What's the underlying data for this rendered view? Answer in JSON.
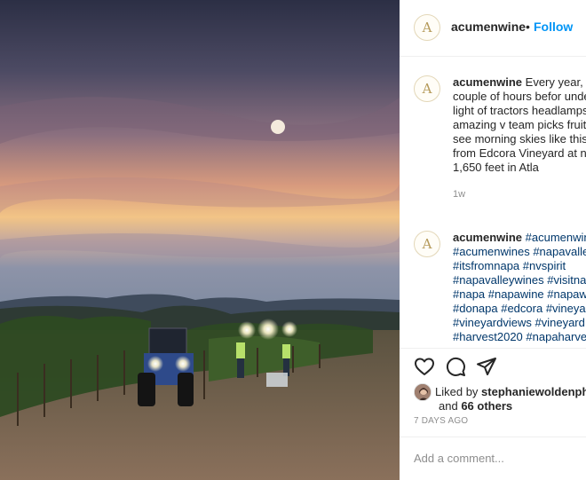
{
  "post": {
    "username": "acumenwine",
    "avatar_letter": "A",
    "separator": "•",
    "follow_label": "Follow",
    "image_icon": "vineyard-harvest-photo"
  },
  "comments": [
    {
      "username": "acumenwine",
      "text": "Every year, —a couple of hours befor under the light of tractors headlamps, our amazing v team picks fruit while see morning skies like this on view from Edcora Vineyard at nearly 1,650 feet in Atla",
      "time": "1w"
    },
    {
      "username": "acumenwine",
      "hashtags": "#acumenwine #acumenwines #napavalley #itsfromnapa #nvspirit #napavalleywines #visitnapa #napa #napawine #napawine #donapa #edcora #vineyard #vineyardviews #vineyard #harvest2020 #napaharvest"
    }
  ],
  "actions": {
    "like_icon": "heart-icon",
    "comment_icon": "comment-icon",
    "share_icon": "share-icon",
    "liked_by_prefix": "Liked by",
    "liked_by_user": "stephaniewoldenph",
    "liked_and": "and",
    "liked_others": "66 others",
    "timestamp": "7 DAYS AGO"
  },
  "add_comment": {
    "placeholder": "Add a comment..."
  },
  "colors": {
    "link_blue": "#0095f6",
    "hashtag": "#00376b",
    "muted": "#8e8e8e",
    "avatar_gold": "#b59a5a"
  }
}
